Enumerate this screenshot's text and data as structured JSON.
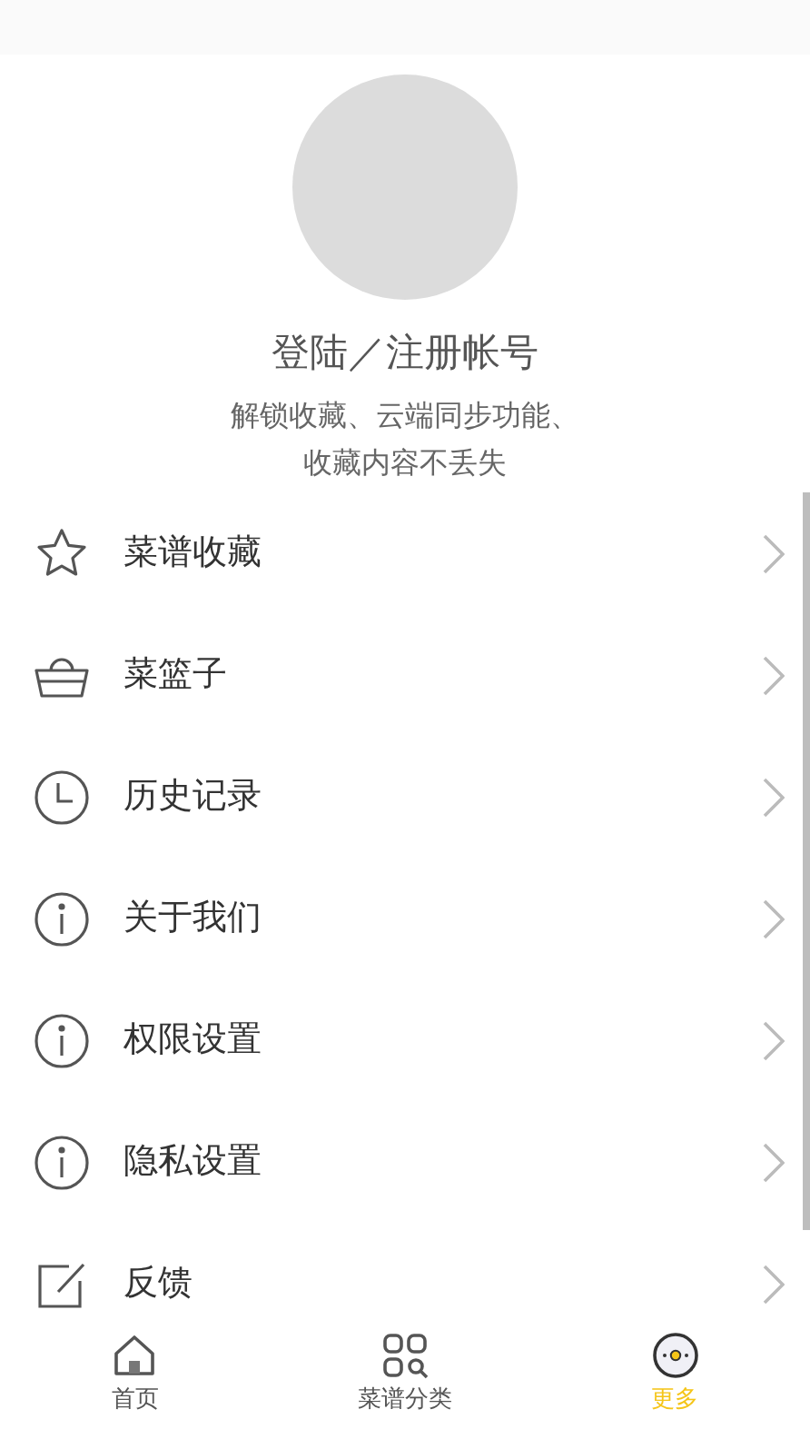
{
  "profile": {
    "title": "登陆／注册帐号",
    "subtitle_lines": [
      "解锁收藏、云端同步功能、",
      "收藏内容不丢失"
    ]
  },
  "menu": [
    {
      "kind": "star",
      "label": "菜谱收藏"
    },
    {
      "kind": "basket",
      "label": "菜篮子"
    },
    {
      "kind": "clock",
      "label": "历史记录"
    },
    {
      "kind": "info",
      "label": "关于我们"
    },
    {
      "kind": "info",
      "label": "权限设置"
    },
    {
      "kind": "info",
      "label": "隐私设置"
    },
    {
      "kind": "edit",
      "label": "反馈"
    }
  ],
  "tabs": [
    {
      "kind": "home",
      "label": "首页",
      "selected": false
    },
    {
      "kind": "grid",
      "label": "菜谱分类",
      "selected": false
    },
    {
      "kind": "more",
      "label": "更多",
      "selected": true
    }
  ]
}
